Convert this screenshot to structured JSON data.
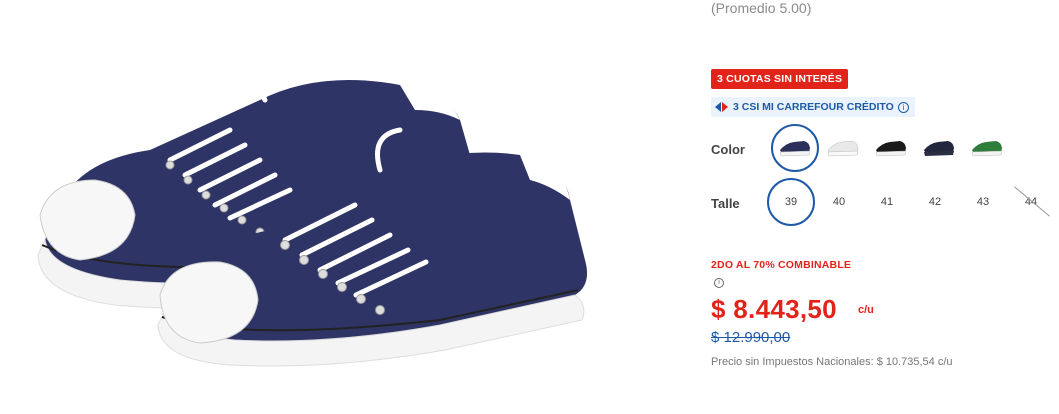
{
  "rating": {
    "average_text": "(Promedio 5.00)"
  },
  "badges": {
    "cuotas": "3 CUOTAS SIN INTERÉS",
    "credito": "3 CSI MI CARREFOUR CRÉDITO"
  },
  "options": {
    "color_label": "Color",
    "size_label": "Talle",
    "colors": [
      {
        "name": "navy",
        "hex": "#2b2f5c",
        "selected": true
      },
      {
        "name": "white",
        "hex": "#e8e8e8",
        "selected": false
      },
      {
        "name": "black",
        "hex": "#1a1a1a",
        "selected": false
      },
      {
        "name": "dark-navy",
        "hex": "#23273d",
        "selected": false
      },
      {
        "name": "green",
        "hex": "#2e7d3b",
        "selected": false
      }
    ],
    "sizes": [
      "39",
      "40",
      "41",
      "42",
      "43",
      "44"
    ],
    "selected_size": "39",
    "unavailable_sizes": [
      "44"
    ]
  },
  "promo": {
    "text": "2DO AL 70% COMBINABLE"
  },
  "price": {
    "current": "$ 8.443,50",
    "unit": "c/u",
    "previous": "$ 12.990,00",
    "tax_note": "Precio sin Impuestos Nacionales: $ 10.735,54 c/u"
  },
  "colors": {
    "accent_red": "#e2231a",
    "accent_blue": "#1e5aa8",
    "shoe_canvas": "#2f3466"
  }
}
